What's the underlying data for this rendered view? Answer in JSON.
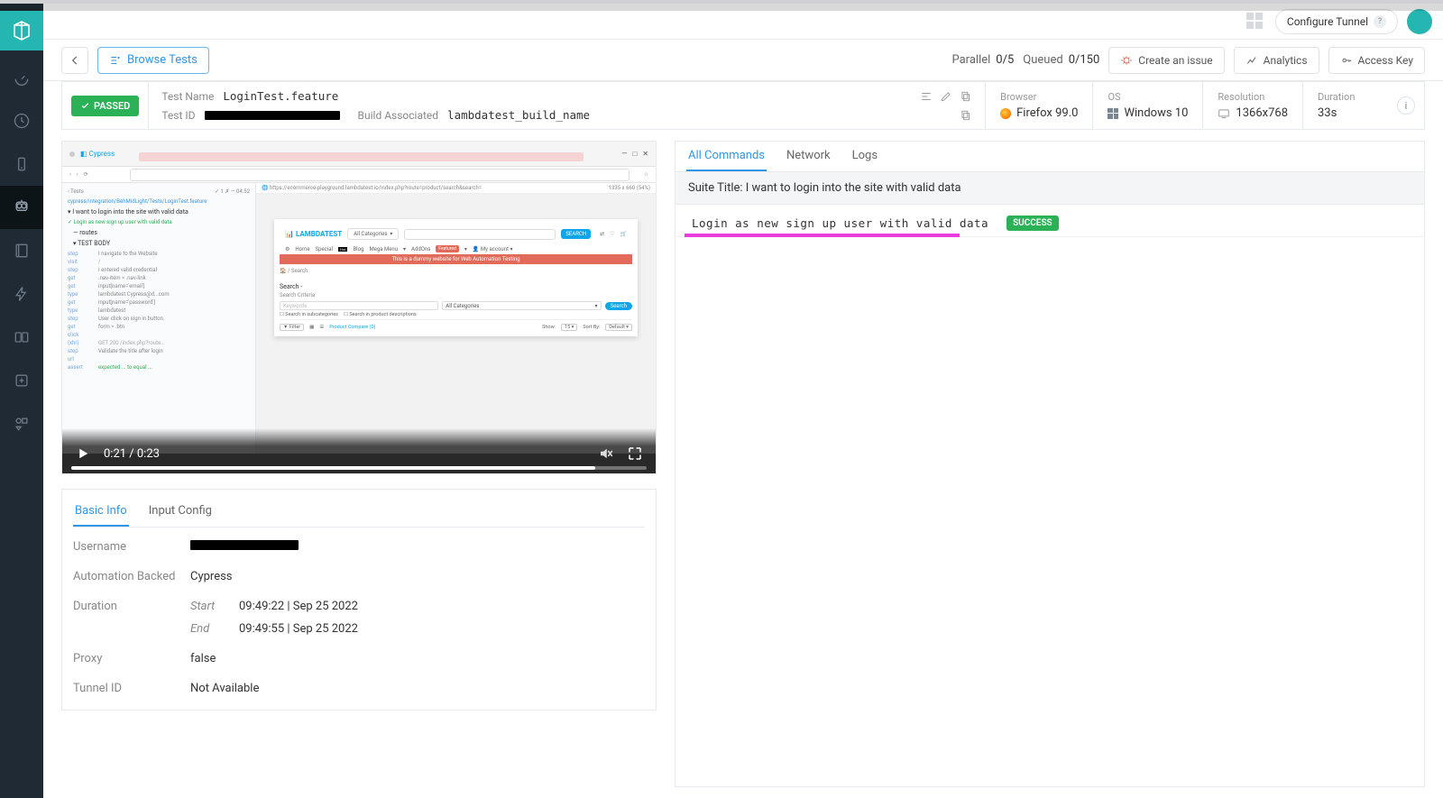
{
  "topbar": {
    "configure_tunnel": "Configure Tunnel"
  },
  "subheader": {
    "browse_tests": "Browse Tests",
    "parallel_label": "Parallel",
    "parallel_value": "0/5",
    "queued_label": "Queued",
    "queued_value": "0/150",
    "create_issue": "Create an issue",
    "analytics": "Analytics",
    "access_key": "Access Key"
  },
  "status": {
    "passed": "PASSED"
  },
  "meta": {
    "test_name_label": "Test Name",
    "test_name": "LoginTest.feature",
    "test_id_label": "Test ID",
    "build_label": "Build Associated",
    "build": "lambdatest_build_name"
  },
  "env": {
    "browser_label": "Browser",
    "browser": "Firefox 99.0",
    "os_label": "OS",
    "os": "Windows 10",
    "resolution_label": "Resolution",
    "resolution": "1366x768",
    "duration_label": "Duration",
    "duration": "33s"
  },
  "video": {
    "time": "0:21 / 0:23"
  },
  "info": {
    "tabs": {
      "basic": "Basic Info",
      "input": "Input Config"
    },
    "username_label": "Username",
    "automation_label": "Automation Backed",
    "automation": "Cypress",
    "duration_label": "Duration",
    "start_label": "Start",
    "start": "09:49:22 | Sep 25 2022",
    "end_label": "End",
    "end": "09:49:55 | Sep 25 2022",
    "proxy_label": "Proxy",
    "proxy": "false",
    "tunnel_label": "Tunnel ID",
    "tunnel": "Not Available"
  },
  "commands": {
    "tabs": {
      "all": "All Commands",
      "network": "Network",
      "logs": "Logs"
    },
    "suite_title": "Suite Title: I want to login into the site with valid data",
    "row1_text": "Login as new sign up user with valid data",
    "success": "SUCCESS"
  },
  "preview": {
    "logo": "LAMBDATEST",
    "all_cat": "All Categories",
    "search_btn": "SEARCH",
    "nav_home": "Home",
    "nav_special": "Special",
    "nav_blog": "Blog",
    "nav_mega": "Mega Menu",
    "nav_addons": "AddOns",
    "nav_featured": "Featured",
    "nav_account": "My account",
    "banner": "This is a dummy website for Web Automation Testing",
    "breadcrumb": "Search",
    "search_section": "Search -",
    "criteria": "Search Criteria",
    "keywords": "Keywords",
    "search_small": "Search",
    "sub1": "Search in subcategories",
    "sub2": "Search in product descriptions",
    "filter": "Filter",
    "compare": "Product Compare (0)",
    "show": "Show:",
    "show_v": "15",
    "sort": "Sort By:",
    "sort_v": "Default",
    "side_h1": "I want to login into the site with valid data",
    "side_h2": "Login as new sign up user with valid data",
    "step1": "I navigate to the Website",
    "step2": "I entered valid credential",
    "step3": "User click on sign in button",
    "step4": "Validate the title after login",
    "time": "04:52"
  }
}
